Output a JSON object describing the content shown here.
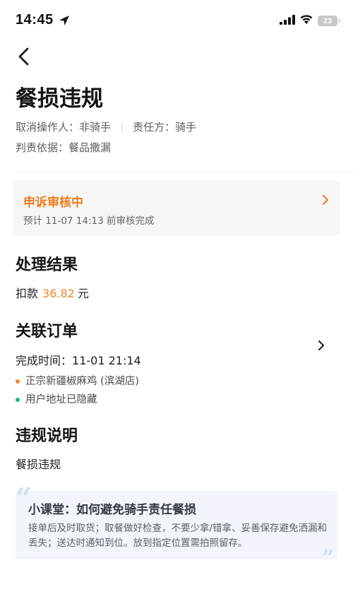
{
  "status_bar": {
    "time": "14:45",
    "battery_level": "23",
    "icons": [
      "location-arrow-icon",
      "signal-icon",
      "wifi-icon",
      "battery-icon"
    ]
  },
  "header": {
    "title": "餐损违规",
    "canceller_label": "取消操作人：",
    "canceller_value": "非骑手",
    "responsible_label": "责任方：",
    "responsible_value": "骑手",
    "basis_label": "判责依据：",
    "basis_value": "餐品撒漏"
  },
  "appeal": {
    "status": "申诉审核中",
    "note": "预计 11-07 14:13 前审核完成",
    "status_color": "#f27a1c"
  },
  "result": {
    "title": "处理结果",
    "deduction_label": "扣款",
    "amount": "36.82",
    "unit": "元",
    "amount_color": "#f08a24"
  },
  "order": {
    "title": "关联订单",
    "completion_label": "完成时间：",
    "completion_time": "11-01 21:14",
    "items": [
      {
        "text": "正宗新疆椒麻鸡 (滨湖店)",
        "dot_color": "#f08a24"
      },
      {
        "text": "用户地址已隐藏",
        "dot_color": "#22b573"
      }
    ]
  },
  "violation": {
    "title": "违规说明",
    "text": "餐损违规"
  },
  "tip": {
    "title": "小课堂：如何避免骑手责任餐损",
    "body": "接单后及时取货；取餐做好检查，不要少拿/错拿、妥善保存避免洒漏和丢失；送达时通知到位。放到指定位置需拍照留存。"
  }
}
